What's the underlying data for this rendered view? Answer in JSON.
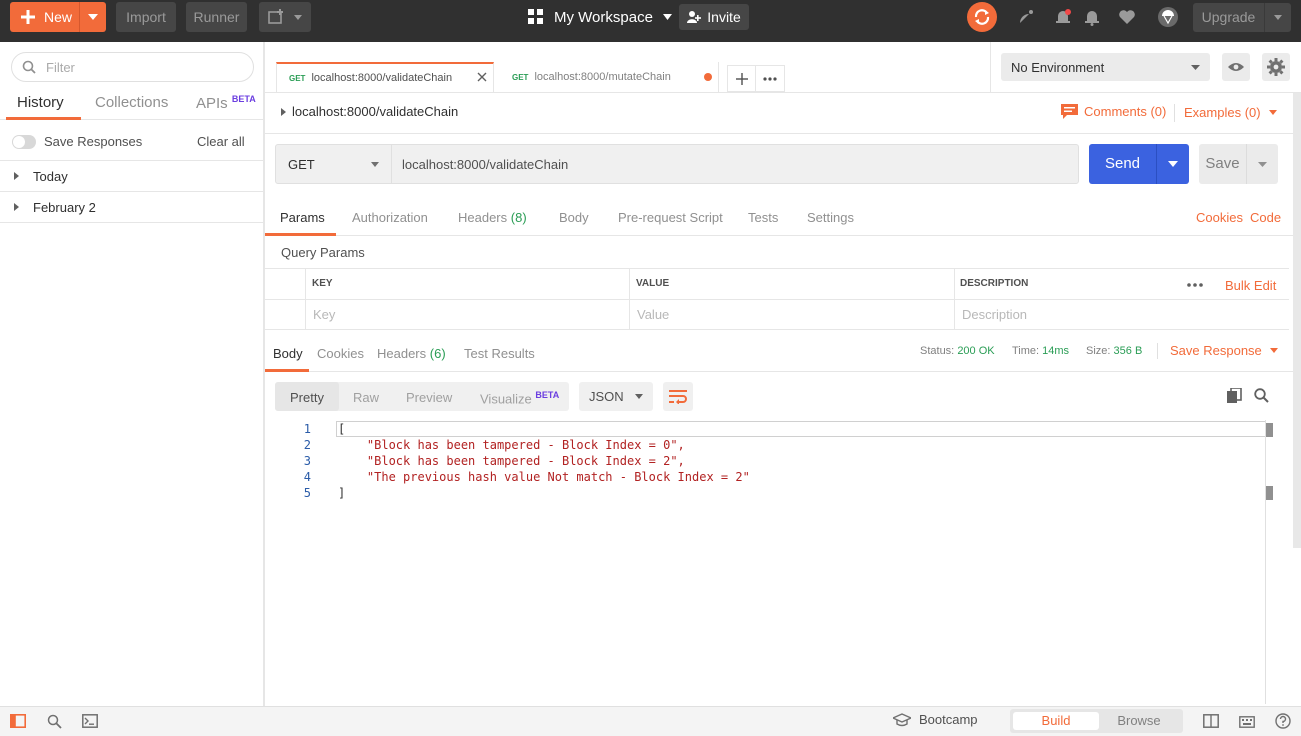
{
  "topbar": {
    "new_label": "New",
    "import_label": "Import",
    "runner_label": "Runner",
    "workspace_label": "My Workspace",
    "invite_label": "Invite",
    "upgrade_label": "Upgrade"
  },
  "sidebar": {
    "filter_placeholder": "Filter",
    "tabs": [
      {
        "label": "History"
      },
      {
        "label": "Collections"
      },
      {
        "label": "APIs",
        "badge": "BETA"
      }
    ],
    "save_responses_label": "Save Responses",
    "clear_all_label": "Clear all",
    "history_groups": [
      {
        "label": "Today"
      },
      {
        "label": "February 2"
      }
    ]
  },
  "request_tabs": [
    {
      "method": "GET",
      "label": "localhost:8000/validateChain"
    },
    {
      "method": "GET",
      "label": "localhost:8000/mutateChain"
    }
  ],
  "environment": {
    "selected": "No Environment"
  },
  "request": {
    "breadcrumb": "localhost:8000/validateChain",
    "comments_label": "Comments (0)",
    "examples_label": "Examples (0)",
    "method": "GET",
    "url": "localhost:8000/validateChain",
    "send_label": "Send",
    "save_label": "Save",
    "tabs": [
      {
        "label": "Params"
      },
      {
        "label": "Authorization"
      },
      {
        "label": "Headers",
        "count": "(8)"
      },
      {
        "label": "Body"
      },
      {
        "label": "Pre-request Script"
      },
      {
        "label": "Tests"
      },
      {
        "label": "Settings"
      }
    ],
    "cookies_label": "Cookies",
    "code_label": "Code",
    "query_params_title": "Query Params",
    "columns": {
      "key": "KEY",
      "value": "VALUE",
      "description": "DESCRIPTION"
    },
    "placeholders": {
      "key": "Key",
      "value": "Value",
      "description": "Description"
    },
    "bulk_edit_label": "Bulk Edit"
  },
  "response": {
    "tabs": [
      {
        "label": "Body"
      },
      {
        "label": "Cookies"
      },
      {
        "label": "Headers",
        "count": "(6)"
      },
      {
        "label": "Test Results"
      }
    ],
    "status_label": "Status:",
    "status_value": "200 OK",
    "time_label": "Time:",
    "time_value": "14ms",
    "size_label": "Size:",
    "size_value": "356 B",
    "save_response_label": "Save Response",
    "formats": [
      {
        "label": "Pretty"
      },
      {
        "label": "Raw"
      },
      {
        "label": "Preview"
      },
      {
        "label": "Visualize",
        "badge": "BETA"
      }
    ],
    "language": "JSON",
    "lines": [
      {
        "no": "1",
        "text": "["
      },
      {
        "no": "2",
        "text": "    \"Block has been tampered - Block Index = 0\","
      },
      {
        "no": "3",
        "text": "    \"Block has been tampered - Block Index = 2\","
      },
      {
        "no": "4",
        "text": "    \"The previous hash value Not match - Block Index = 2\""
      },
      {
        "no": "5",
        "text": "]"
      }
    ]
  },
  "statusbar": {
    "bootcamp_label": "Bootcamp",
    "build_label": "Build",
    "browse_label": "Browse"
  },
  "colors": {
    "accent": "#f26b3a",
    "send": "#3b62e0",
    "success": "#2a9d55",
    "topbar": "#303030"
  }
}
